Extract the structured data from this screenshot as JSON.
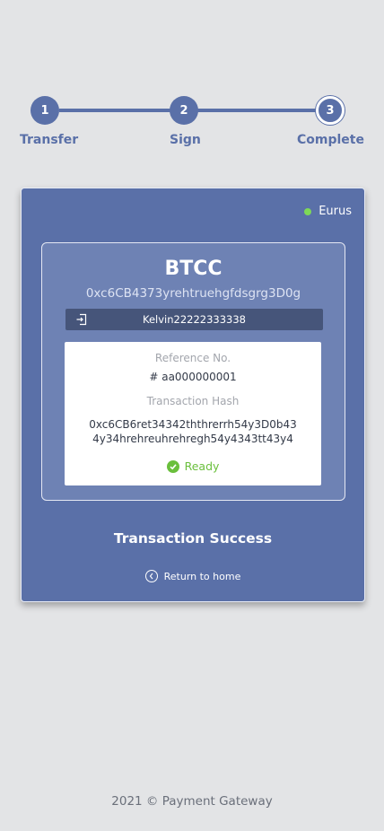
{
  "stepper": {
    "steps": [
      {
        "number": "1",
        "label": "Transfer"
      },
      {
        "number": "2",
        "label": "Sign"
      },
      {
        "number": "3",
        "label": "Complete"
      }
    ],
    "active_step": 3
  },
  "card": {
    "network": {
      "label": "Eurus",
      "status_color": "#7ed957",
      "icon": "status-dot-icon"
    },
    "coin": {
      "name": "BTCC",
      "address": "0xc6CB4373yrehtruehgfdsgrg3D0g"
    },
    "account": {
      "icon": "import-icon",
      "name": "Kelvin22222333338"
    },
    "details": {
      "reference_label": "Reference No.",
      "reference_value": "# aa000000001",
      "hash_label": "Transaction Hash",
      "hash_value": "0xc6CB6ret34342ththrerrh54y3D0b43 4y34hrehreuhrehregh54y4343tt43y4",
      "status_icon": "check-circle-icon",
      "status_label": "Ready",
      "status_color": "#6abf3c"
    },
    "transaction_status": "Transaction Success",
    "return_link": {
      "icon": "chevron-left-circle-icon",
      "label": "Return to home"
    }
  },
  "colors": {
    "primary": "#5a70a8",
    "background": "#e3e4e6"
  },
  "footer": {
    "text": "2021 © Payment Gateway"
  }
}
